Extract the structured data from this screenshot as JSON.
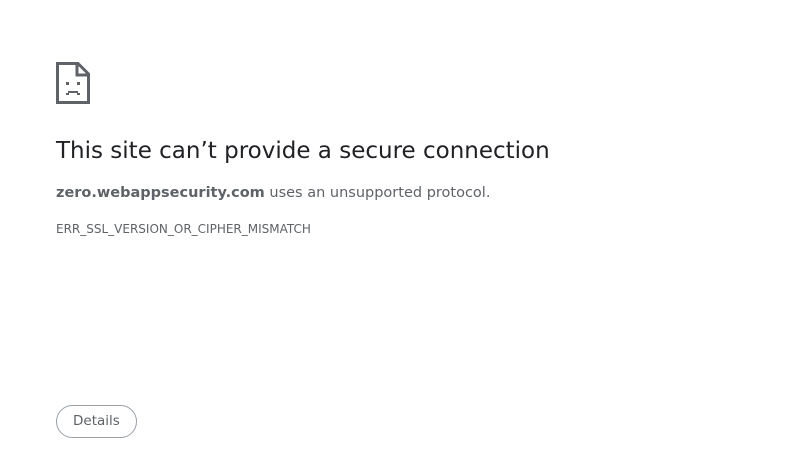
{
  "error": {
    "icon": "sad-document-icon",
    "title": "This site can’t provide a secure connection",
    "host": "zero.webappsecurity.com",
    "message_suffix": " uses an unsupported protocol.",
    "code": "ERR_SSL_VERSION_OR_CIPHER_MISMATCH"
  },
  "actions": {
    "details_label": "Details"
  },
  "colors": {
    "title": "#202124",
    "text": "#5f6368",
    "button_border": "#9aa0a6"
  }
}
